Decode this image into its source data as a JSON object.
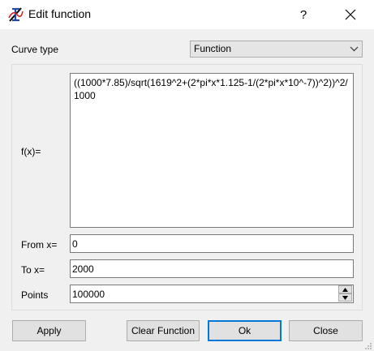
{
  "window": {
    "title": "Edit function",
    "help_label": "?",
    "app_icon": "curve-fit-app-icon",
    "close_icon": "close-icon"
  },
  "curve_type": {
    "label": "Curve type",
    "selected": "Function",
    "icon": "chevron-down-icon"
  },
  "function": {
    "label": "f(x)=",
    "expression": "((1000*7.85)/sqrt(1619^2+(2*pi*x*1.125-1/(2*pi*x*10^-7))^2))^2/1000"
  },
  "range": {
    "from_label": "From x=",
    "from_value": "0",
    "to_label": "To x=",
    "to_value": "2000",
    "points_label": "Points",
    "points_value": "100000"
  },
  "buttons": {
    "apply": "Apply",
    "clear": "Clear Function",
    "ok": "Ok",
    "close": "Close"
  },
  "colors": {
    "focus_border": "#0078d7",
    "button_face": "#e1e1e1",
    "dialog_bg": "#f0f0f0"
  }
}
